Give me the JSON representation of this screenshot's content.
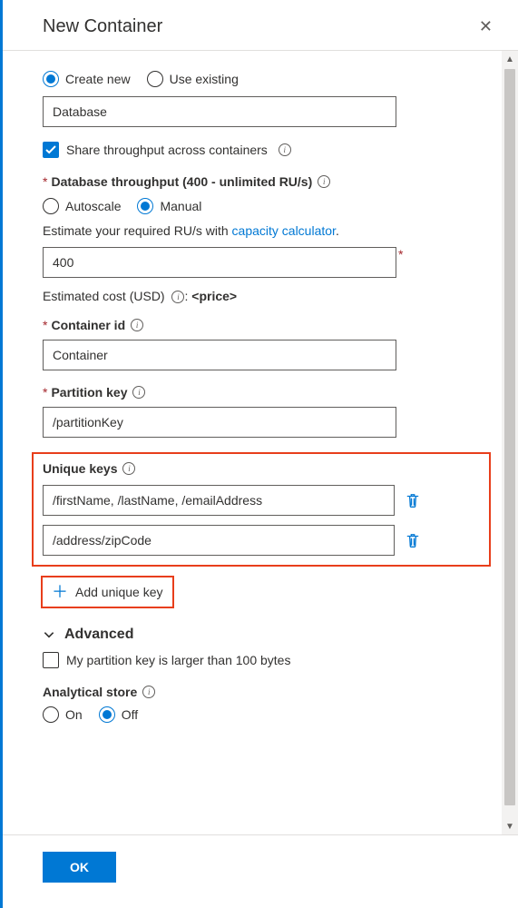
{
  "header": {
    "title": "New Container"
  },
  "database_mode": {
    "create_new": "Create new",
    "use_existing": "Use existing",
    "selected": "create_new",
    "input_value": "Database"
  },
  "share_throughput": {
    "label": "Share throughput across containers",
    "checked": true
  },
  "throughput": {
    "label": "Database throughput (400 - unlimited RU/s)",
    "autoscale": "Autoscale",
    "manual": "Manual",
    "selected": "manual",
    "helper_prefix": "Estimate your required RU/s with ",
    "helper_link": "capacity calculator",
    "helper_suffix": ".",
    "value": "400",
    "estimated_label": "Estimated cost (USD) ",
    "estimated_suffix": ": ",
    "estimated_value": "<price>"
  },
  "container_id": {
    "label": "Container id",
    "value": "Container"
  },
  "partition_key": {
    "label": "Partition key",
    "value": "/partitionKey"
  },
  "unique_keys": {
    "label": "Unique keys",
    "rows": [
      "/firstName, /lastName, /emailAddress",
      "/address/zipCode"
    ],
    "add_label": "Add unique key"
  },
  "advanced": {
    "label": "Advanced",
    "partition_large_label": "My partition key is larger than 100 bytes",
    "partition_large_checked": false
  },
  "analytical": {
    "label": "Analytical store",
    "on": "On",
    "off": "Off",
    "selected": "off"
  },
  "footer": {
    "ok": "OK"
  }
}
